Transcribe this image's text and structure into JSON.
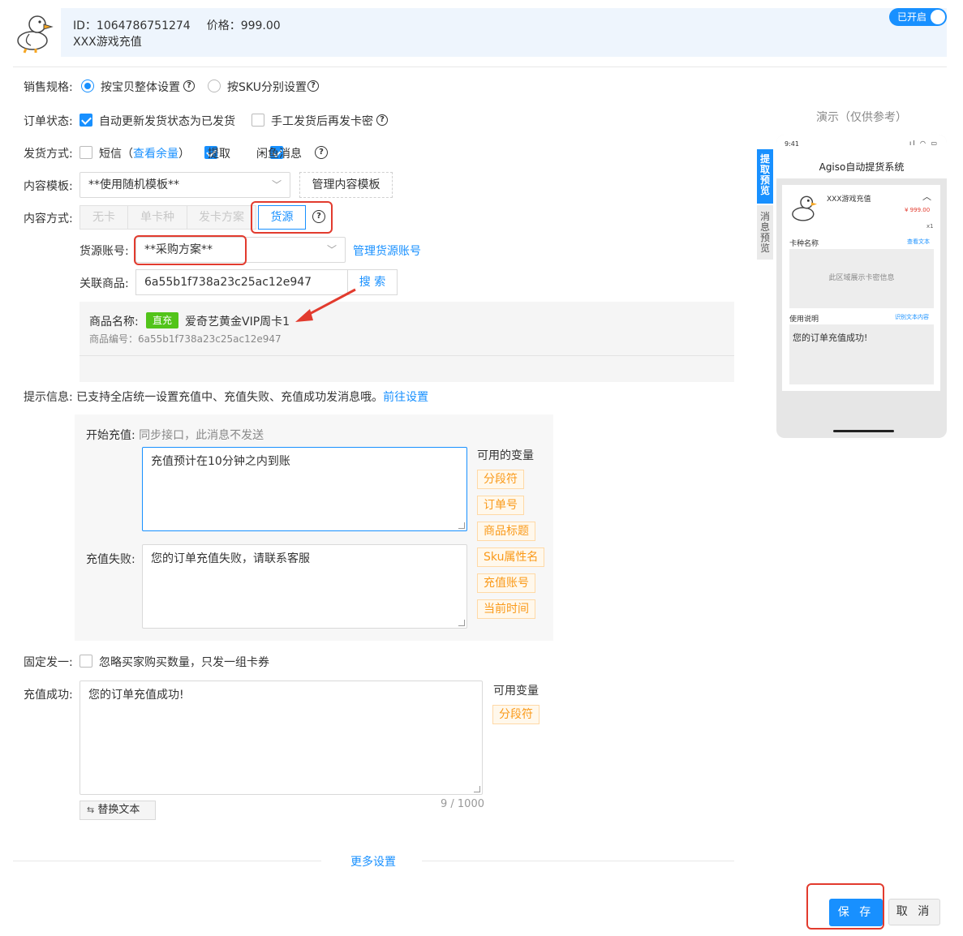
{
  "header": {
    "id_label": "ID：1064786751274",
    "price_label": "价格：999.00",
    "title": "XXX游戏充值",
    "toggle_label": "已开启"
  },
  "sale_spec": {
    "label": "销售规格:",
    "option_whole": "按宝贝整体设置",
    "option_sku": "按SKU分别设置"
  },
  "order_status": {
    "label": "订单状态:",
    "auto_update": "自动更新发货状态为已发货",
    "manual_send": "手工发货后再发卡密"
  },
  "ship_method": {
    "label": "发货方式:",
    "sms": "短信",
    "sms_paren_open": "（",
    "check_balance": "查看余量",
    "sms_paren_close": "）",
    "pickup": "提取",
    "xianyu": "闲鱼消息"
  },
  "content_template": {
    "label": "内容模板:",
    "selected": "**使用随机模板**",
    "manage_button": "管理内容模板"
  },
  "content_method": {
    "label": "内容方式:",
    "options": [
      "无卡",
      "单卡种",
      "发卡方案",
      "货源"
    ],
    "active": "货源"
  },
  "source_account": {
    "label": "货源账号:",
    "selected": "**采购方案**",
    "manage_link": "管理货源账号"
  },
  "related_product": {
    "label": "关联商品:",
    "value": "6a55b1f738a23c25ac12e947",
    "search_button": "搜 索"
  },
  "product_info": {
    "name_label": "商品名称:",
    "tag": "直充",
    "name": "爱奇艺黄金VIP周卡1",
    "code_label": "商品编号：6a55b1f738a23c25ac12e947"
  },
  "tip_info": {
    "label": "提示信息:",
    "text": "已支持全店统一设置充值中、充值失败、充值成功发消息哦。",
    "link": "前往设置"
  },
  "recharge_messages": {
    "start_label": "开始充值:",
    "start_note": "同步接口，此消息不发送",
    "start_text": "充值预计在10分钟之内到账",
    "fail_label": "充值失败:",
    "fail_text": "您的订单充值失败，请联系客服",
    "vars_title": "可用的变量",
    "vars": [
      "分段符",
      "订单号",
      "商品标题",
      "Sku属性名",
      "充值账号",
      "当前时间"
    ]
  },
  "fixed_one": {
    "label": "固定发一:",
    "text": "忽略买家购买数量，只发一组卡券"
  },
  "recharge_success": {
    "label": "充值成功:",
    "text": "您的订单充值成功!",
    "counter": "9 / 1000",
    "replace_button": "替换文本",
    "vars_title": "可用变量",
    "vars": [
      "分段符"
    ]
  },
  "more_settings": "更多设置",
  "actions": {
    "save": "保 存",
    "cancel": "取 消"
  },
  "demo": {
    "title": "演示（仅供参考）",
    "tab_pickup": "提取预览",
    "tab_message": "消息预览",
    "status_time": "9:41",
    "app_title": "Agiso自动提货系统",
    "product_title": "XXX游戏充值",
    "price": "¥ 999.00",
    "qty": "x1",
    "card_type_label": "卡种名称",
    "view_text_link": "查看文本",
    "card_area_text": "此区域展示卡密信息",
    "usage_label": "使用说明",
    "recognize_link": "识别文本内容",
    "usage_text": "您的订单充值成功!"
  },
  "colors": {
    "primary": "#1890ff",
    "highlight_red": "#e23b2e",
    "tag_green": "#52c41a",
    "var_orange": "#fa9a1a"
  }
}
